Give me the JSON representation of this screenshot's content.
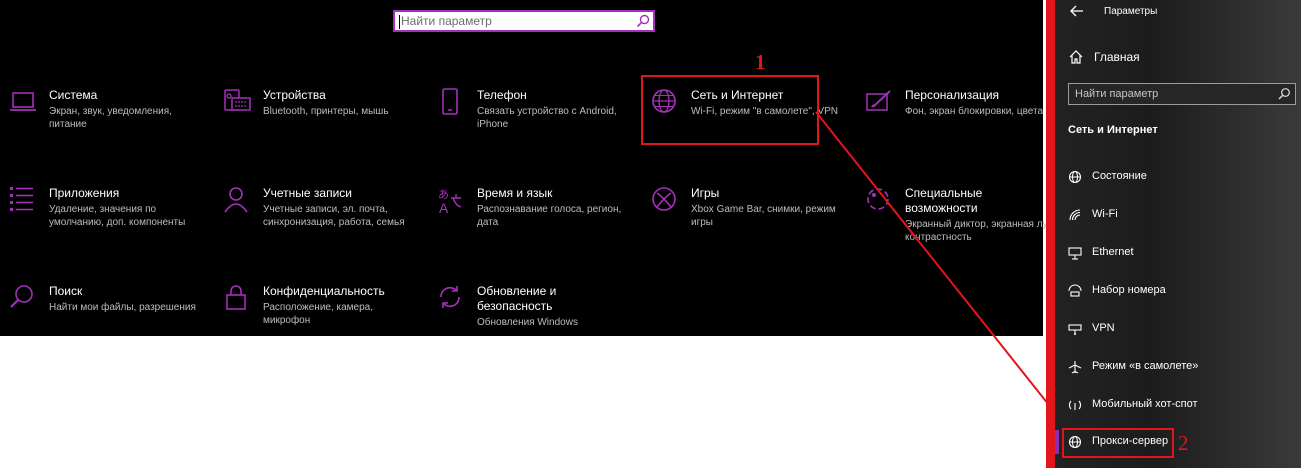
{
  "colors": {
    "accent": "#a431ba",
    "annotation": "#e0161b",
    "background": "#000000",
    "description": "#bdbdbd"
  },
  "home": {
    "search": {
      "placeholder": "Найти параметр",
      "icon": "search-icon"
    },
    "tiles": [
      {
        "title": "Система",
        "description": "Экран, звук, уведомления, питание",
        "icon": "laptop-icon"
      },
      {
        "title": "Устройства",
        "description": "Bluetooth, принтеры, мышь",
        "icon": "keyboard-speaker-icon"
      },
      {
        "title": "Телефон",
        "description": "Связать устройство с Android, iPhone",
        "icon": "phone-icon"
      },
      {
        "title": "Сеть и Интернет",
        "description": "Wi-Fi, режим \"в самолете\", VPN",
        "icon": "globe-icon"
      },
      {
        "title": "Персонализация",
        "description": "Фон, экран блокировки, цвета",
        "icon": "paint-icon"
      },
      {
        "title": "Приложения",
        "description": "Удаление, значения по умолчанию, доп. компоненты",
        "icon": "apps-list-icon"
      },
      {
        "title": "Учетные записи",
        "description": "Учетные записи, эл. почта, синхронизация, работа, семья",
        "icon": "person-icon"
      },
      {
        "title": "Время и язык",
        "description": "Распознавание голоса, регион, дата",
        "icon": "time-language-icon"
      },
      {
        "title": "Игры",
        "description": "Xbox Game Bar, снимки, режим игры",
        "icon": "xbox-icon"
      },
      {
        "title": "Специальные возможности",
        "description": "Экранный диктор, экранная лупа, контрастность",
        "icon": "ease-of-access-icon"
      },
      {
        "title": "Поиск",
        "description": "Найти мои файлы, разрешения",
        "icon": "search-icon"
      },
      {
        "title": "Конфиденциальность",
        "description": "Расположение, камера, микрофон",
        "icon": "lock-icon"
      },
      {
        "title": "Обновление и безопасность",
        "description": "Обновления Windows",
        "icon": "update-icon"
      }
    ]
  },
  "annotations": {
    "first": "1",
    "second": "2"
  },
  "panel": {
    "title": "Параметры",
    "back_icon": "back-arrow-icon",
    "home_label": "Главная",
    "search_placeholder": "Найти параметр",
    "section_title": "Сеть и Интернет",
    "items": [
      {
        "label": "Состояние",
        "icon": "status-globe-icon"
      },
      {
        "label": "Wi-Fi",
        "icon": "wifi-icon"
      },
      {
        "label": "Ethernet",
        "icon": "ethernet-icon"
      },
      {
        "label": "Набор номера",
        "icon": "dialup-icon"
      },
      {
        "label": "VPN",
        "icon": "vpn-icon"
      },
      {
        "label": "Режим «в самолете»",
        "icon": "airplane-icon"
      },
      {
        "label": "Мобильный хот-спот",
        "icon": "hotspot-icon"
      },
      {
        "label": "Прокси-сервер",
        "icon": "proxy-globe-icon"
      }
    ]
  }
}
